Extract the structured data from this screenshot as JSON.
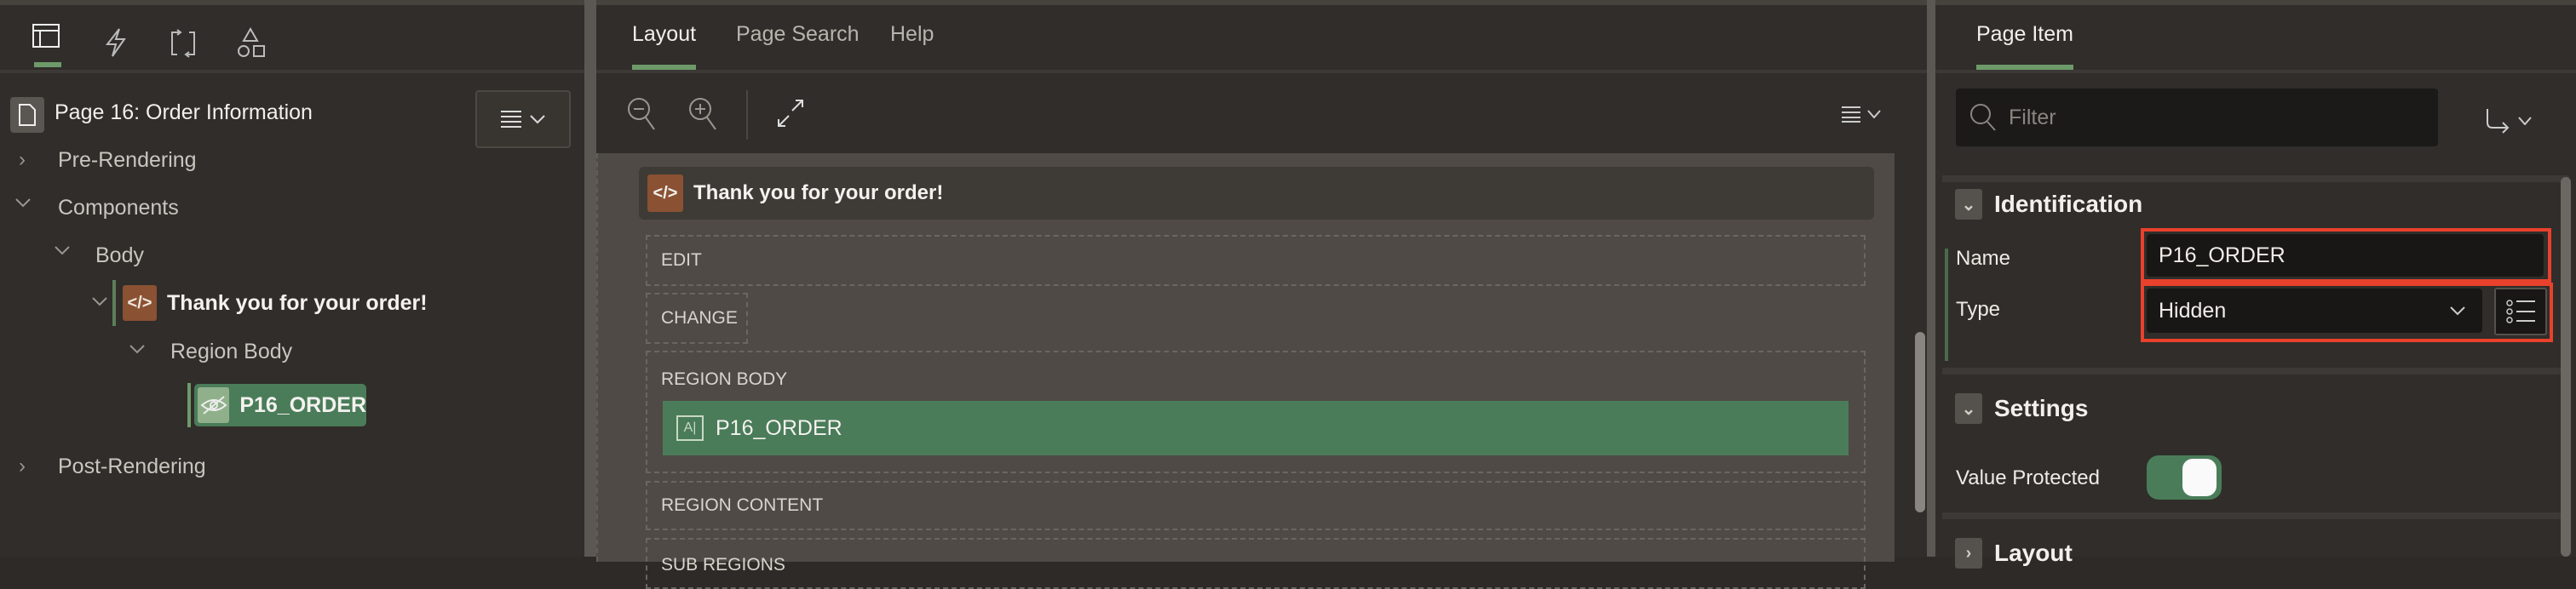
{
  "left_panel": {
    "tabs": [
      {
        "icon": "rendering-tree-icon",
        "active": true
      },
      {
        "icon": "dynamic-actions-icon"
      },
      {
        "icon": "processing-icon"
      },
      {
        "icon": "shared-components-icon"
      }
    ],
    "page_title": "Page 16: Order Information",
    "tree": {
      "pre_rendering": "Pre-Rendering",
      "components": "Components",
      "body": "Body",
      "region": "Thank you for your order!",
      "region_body": "Region Body",
      "item": "P16_ORDER",
      "post_rendering": "Post-Rendering"
    }
  },
  "center_panel": {
    "tabs": [
      "Layout",
      "Page Search",
      "Help"
    ],
    "region_title": "Thank you for your order!",
    "slots": {
      "edit": "EDIT",
      "change": "CHANGE",
      "region_body": "REGION BODY",
      "item": "P16_ORDER",
      "region_content": "REGION CONTENT",
      "sub_regions": "SUB REGIONS"
    }
  },
  "right_panel": {
    "tab": "Page Item",
    "filter_placeholder": "Filter",
    "sections": {
      "identification": "Identification",
      "settings": "Settings",
      "layout": "Layout"
    },
    "name_label": "Name",
    "name_value": "P16_ORDER",
    "type_label": "Type",
    "type_value": "Hidden",
    "value_protected_label": "Value Protected",
    "value_protected": true
  },
  "colors": {
    "accent_green": "#4a7c59",
    "highlight_red": "#e8412c",
    "region_brown": "#8a5133"
  }
}
